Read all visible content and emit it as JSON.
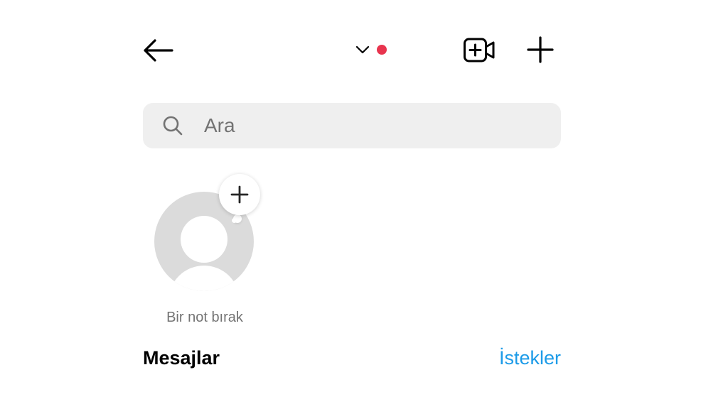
{
  "header": {
    "back_icon": "arrow-left-icon",
    "switcher_icon": "chevron-down-icon",
    "video_icon": "video-call-add-icon",
    "new_icon": "plus-icon"
  },
  "search": {
    "placeholder": "Ara",
    "value": ""
  },
  "note": {
    "label": "Bir not bırak",
    "bubble_icon": "plus-icon"
  },
  "messages": {
    "title": "Mesajlar",
    "requests_label": "İstekler"
  },
  "colors": {
    "accent": "#1c9be8",
    "notification": "#e8344e",
    "search_bg": "#efefef",
    "avatar_bg": "#dbdbdb",
    "icon": "#000000"
  }
}
